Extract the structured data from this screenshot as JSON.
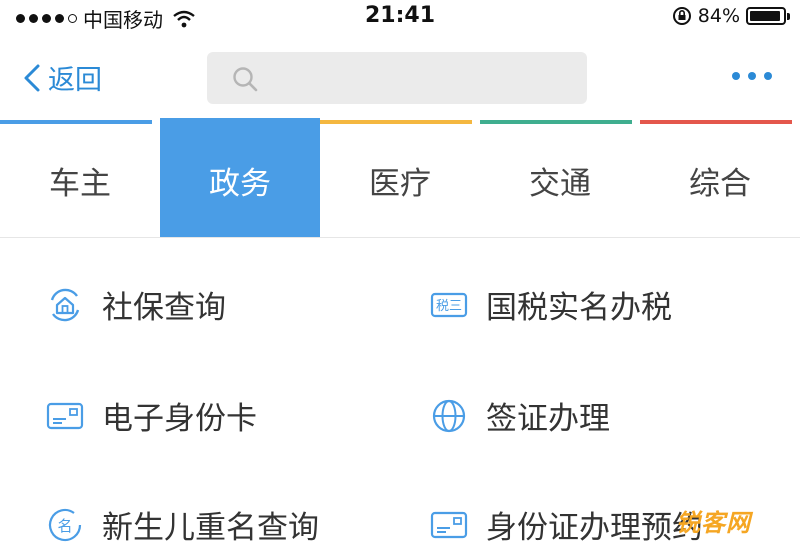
{
  "status": {
    "carrier": "中国移动",
    "time": "21:41",
    "battery": "84%"
  },
  "nav": {
    "back_label": "返回",
    "search_placeholder": ""
  },
  "tabs": [
    {
      "label": "车主",
      "color": "#4a9de6"
    },
    {
      "label": "政务",
      "color": "#4a9de6"
    },
    {
      "label": "医疗",
      "color": "#f4b740"
    },
    {
      "label": "交通",
      "color": "#3fae8f"
    },
    {
      "label": "综合",
      "color": "#e4574c"
    }
  ],
  "active_tab": "政务",
  "items": [
    {
      "label": "社保查询",
      "icon": "house-shield-icon"
    },
    {
      "label": "国税实名办税",
      "icon": "tax-badge-icon"
    },
    {
      "label": "电子身份卡",
      "icon": "id-card-icon"
    },
    {
      "label": "签证办理",
      "icon": "globe-icon"
    },
    {
      "label": "新生儿重名查询",
      "icon": "name-search-icon"
    },
    {
      "label": "身份证办理预约",
      "icon": "id-card-icon"
    }
  ],
  "watermark": "锐客网",
  "accent": "#2b8ad6"
}
